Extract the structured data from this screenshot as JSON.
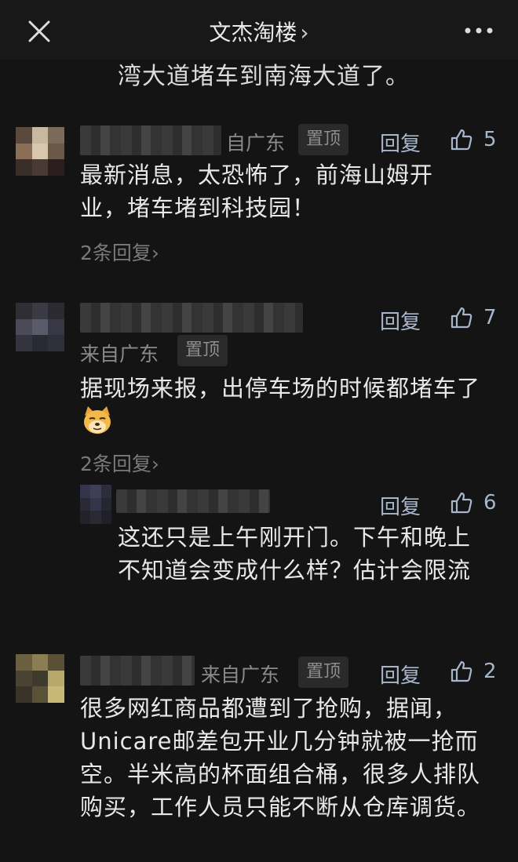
{
  "header": {
    "title": "文杰淘楼",
    "title_chevron": "›",
    "more": "•••"
  },
  "previous_comment_tail": "湾大道堵车到南海大道了。",
  "comments": [
    {
      "location": "自广东",
      "pin": "置顶",
      "reply": "回复",
      "likes": "5",
      "text": "最新消息，太恐怖了，前海山姆开业，堵车堵到科技园！",
      "reply_count": "2条回复›"
    },
    {
      "location": "来自广东",
      "pin": "置顶",
      "reply": "回复",
      "likes": "7",
      "text": "据现场来报，出停车场的时候都堵车了",
      "reply_count": "2条回复›"
    },
    {
      "reply": "回复",
      "likes": "6",
      "text": "这还只是上午刚开门。下午和晚上不知道会变成什么样？估计会限流"
    },
    {
      "location": "来自广东",
      "pin": "置顶",
      "reply": "回复",
      "likes": "2",
      "text": "很多网红商品都遭到了抢购，据闻，Unicare邮差包开业几分钟就被一抢而空。半米高的杯面组合桶，很多人排队购买，工作人员只能不断从仓库调货。"
    }
  ],
  "colors": {
    "background": "#141414",
    "accent": "#a8b6cc",
    "muted": "#8a8a8a"
  }
}
